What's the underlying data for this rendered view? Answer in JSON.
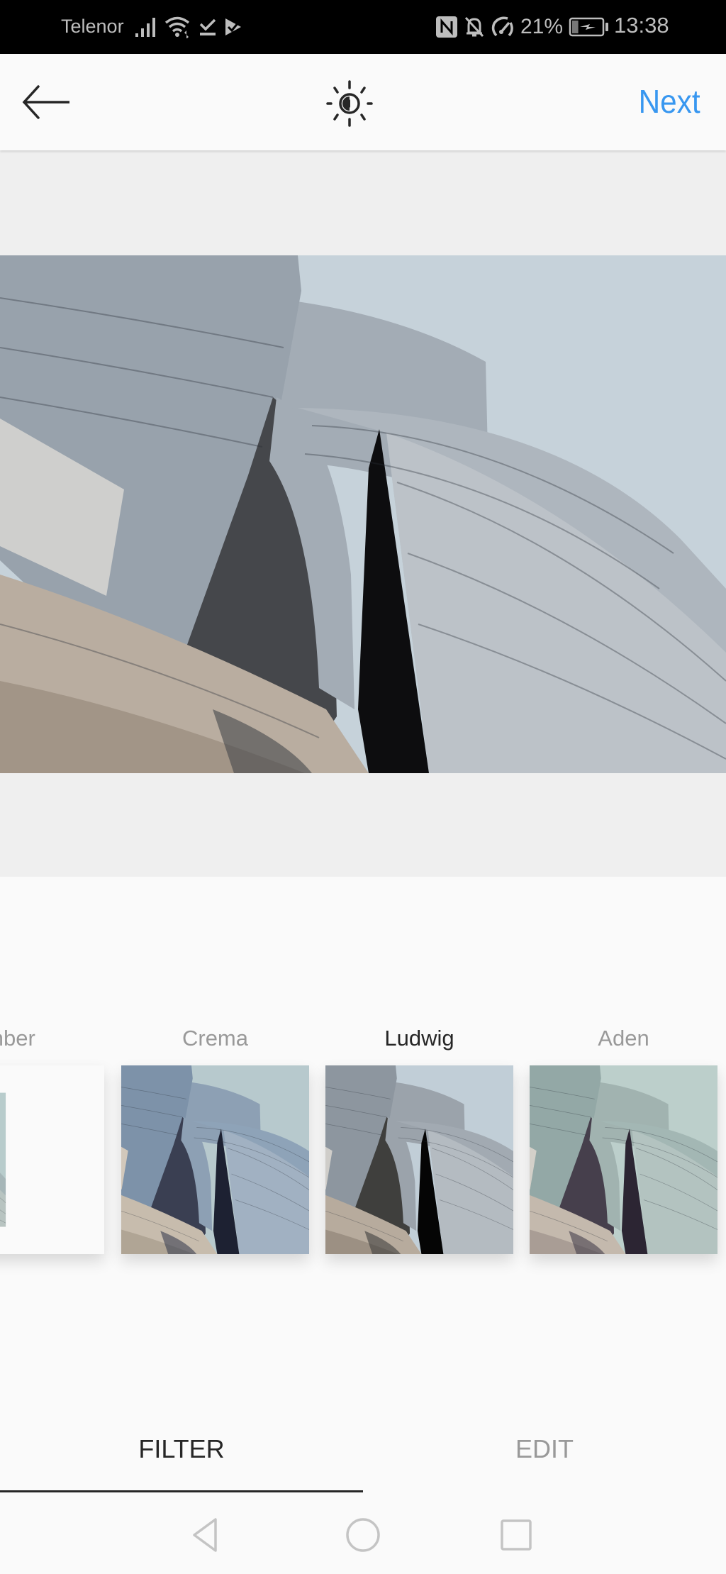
{
  "status_bar": {
    "carrier": "Telenor",
    "left_icons": [
      "signal-icon",
      "wifi-icon",
      "download-done-icon",
      "play-store-icon"
    ],
    "right_icons": [
      "nfc-icon",
      "bell-off-icon",
      "speedometer-icon"
    ],
    "battery_percent": "21%",
    "battery_level": 0.21,
    "battery_charging": true,
    "time": "13:38"
  },
  "app_bar": {
    "back_icon": "arrow-left-icon",
    "lux_icon": "lux-brightness-icon",
    "next_label": "Next",
    "accent_color": "#3897f0"
  },
  "preview": {
    "description": "Walt Disney Concert Hall stainless steel facade",
    "background_color": "#efefef"
  },
  "filters": {
    "items": [
      {
        "label": "Amber",
        "visible_label": "mber",
        "active": false
      },
      {
        "label": "Crema",
        "visible_label": "Crema",
        "active": false
      },
      {
        "label": "Ludwig",
        "visible_label": "Ludwig",
        "active": true
      },
      {
        "label": "Aden",
        "visible_label": "Aden",
        "active": false
      }
    ],
    "selected": "Ludwig"
  },
  "tabs": {
    "items": [
      {
        "label": "FILTER",
        "active": true
      },
      {
        "label": "EDIT",
        "active": false
      }
    ]
  },
  "nav_bar": {
    "buttons": [
      "back-triangle-icon",
      "home-circle-icon",
      "recents-square-icon"
    ]
  }
}
